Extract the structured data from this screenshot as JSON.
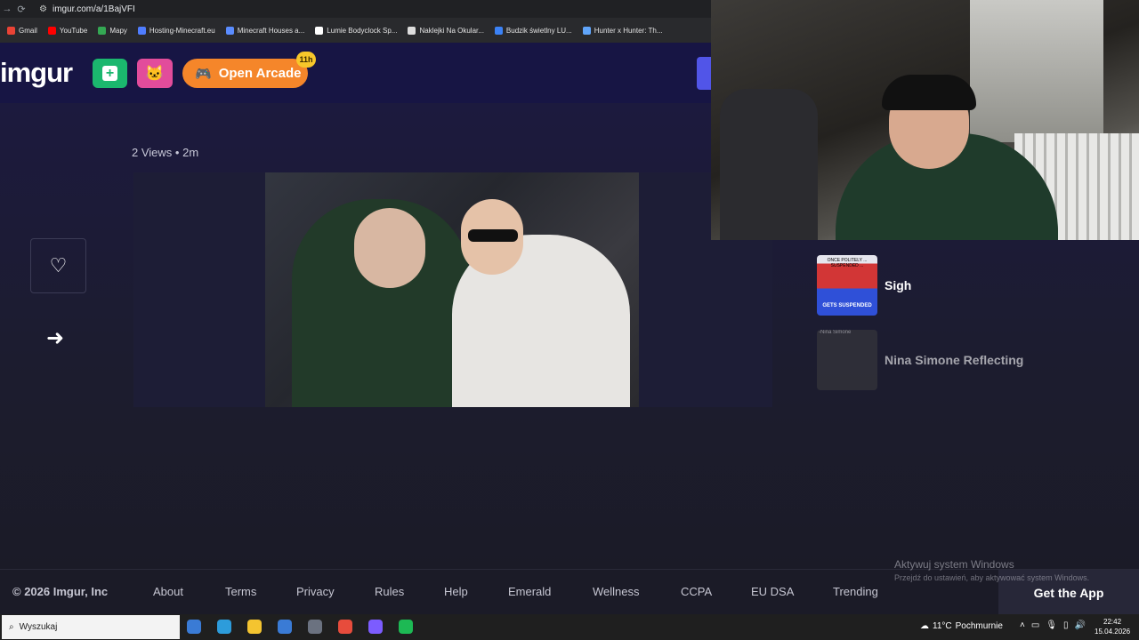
{
  "browser": {
    "url": "imgur.com/a/1BajVFI",
    "bookmarks": [
      {
        "label": "Gmail",
        "color": "#ea4335"
      },
      {
        "label": "YouTube",
        "color": "#ff0000"
      },
      {
        "label": "Mapy",
        "color": "#34a853"
      },
      {
        "label": "Hosting-Minecraft.eu",
        "color": "#4f7dff"
      },
      {
        "label": "Minecraft Houses a...",
        "color": "#5a8cff"
      },
      {
        "label": "Lumie Bodyclock Sp...",
        "color": "#ffffff"
      },
      {
        "label": "Naklejki Na Okular...",
        "color": "#dddddd"
      },
      {
        "label": "Budzik świetlny LU...",
        "color": "#3b82f6"
      },
      {
        "label": "Hunter x Hunter: Th...",
        "color": "#60a5fa"
      }
    ]
  },
  "header": {
    "logo": "imgur",
    "arcade_label": "Open Arcade",
    "arcade_badge": "11h"
  },
  "post": {
    "views": "2 Views",
    "separator": "•",
    "age": "2m"
  },
  "sidebar": {
    "items": [
      {
        "title": "Sigh",
        "thumb_caption_top": "ONCE POLITELY ... SUSPENDED ...",
        "thumb_caption_bottom": "GETS SUSPENDED"
      },
      {
        "title": "Nina Simone Reflecting",
        "thumb_caption_top": "-Nina Simone"
      }
    ]
  },
  "footer": {
    "copyright": "© 2026 Imgur, Inc",
    "links": [
      "About",
      "Terms",
      "Privacy",
      "Rules",
      "Help",
      "Emerald",
      "Wellness",
      "CCPA",
      "EU DSA",
      "Trending"
    ],
    "get_app": "Get the App"
  },
  "watermark": {
    "line1": "Aktywuj system Windows",
    "line2": "Przejdź do ustawień, aby aktywować system Windows."
  },
  "taskbar": {
    "search_placeholder": "Wyszukaj",
    "apps": [
      "#3a7bd5",
      "#2d9cdb",
      "#f4c430",
      "#3a7bd5",
      "#6b7280",
      "#e74c3c",
      "#7c5cff",
      "#1db954"
    ],
    "temperature": "11°C",
    "weather": "Pochmurnie",
    "time": "22:42",
    "date": "15.04.2026"
  }
}
